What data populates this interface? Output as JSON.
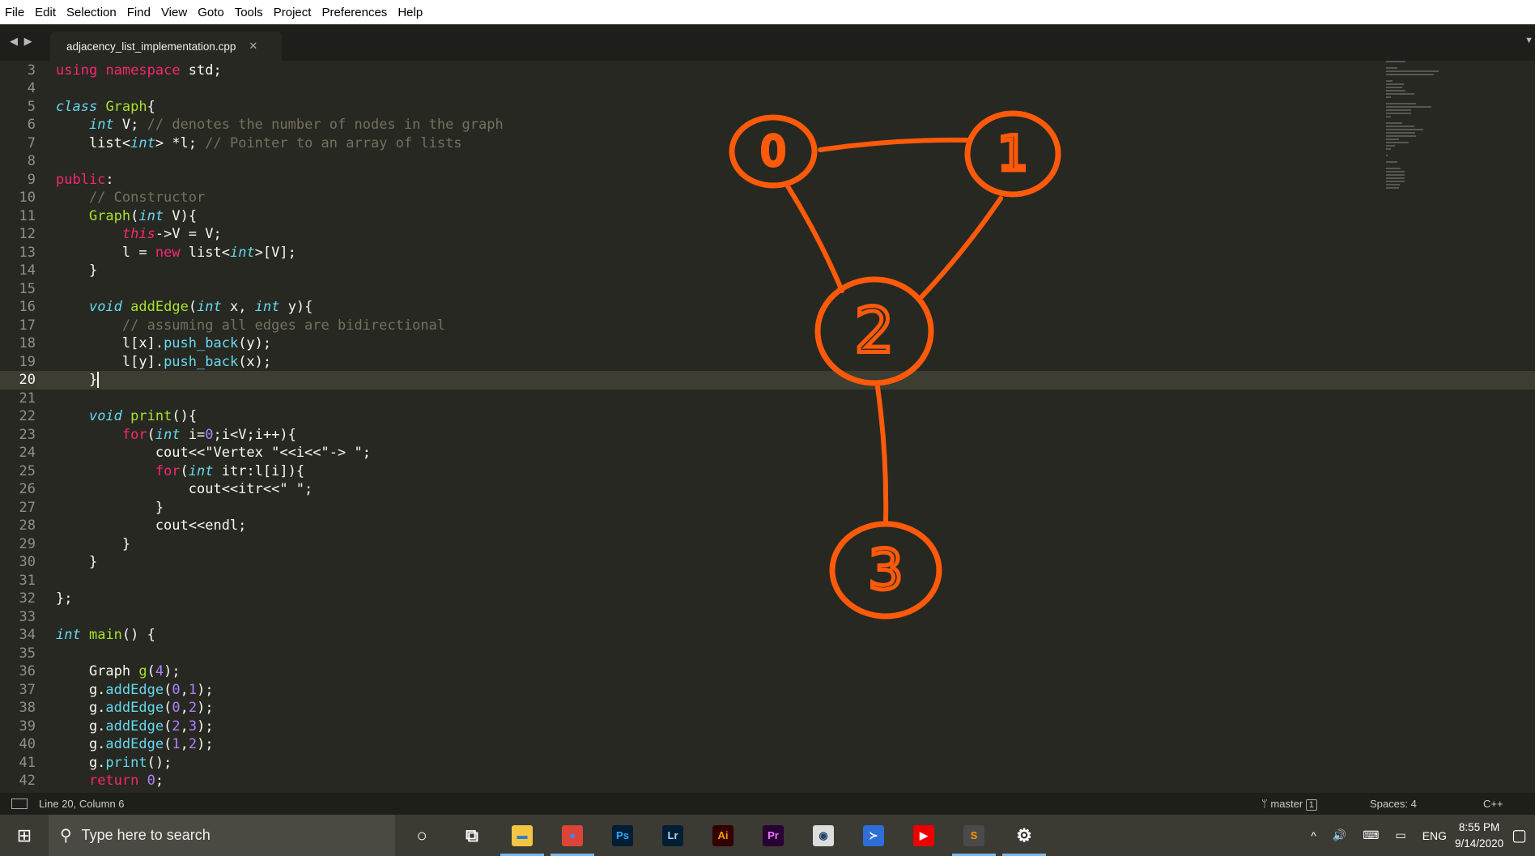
{
  "menu": [
    "File",
    "Edit",
    "Selection",
    "Find",
    "View",
    "Goto",
    "Tools",
    "Project",
    "Preferences",
    "Help"
  ],
  "tab": {
    "nav": "◀ ▶",
    "filename": "adjacency_list_implementation.cpp",
    "close": "✕"
  },
  "current_line": 20,
  "code": [
    {
      "n": "3",
      "t": [
        [
          "kw",
          "using"
        ],
        [
          "",
          " "
        ],
        [
          "kw",
          "namespace"
        ],
        [
          "",
          " std;"
        ]
      ]
    },
    {
      "n": "4",
      "t": []
    },
    {
      "n": "5",
      "t": [
        [
          "ty",
          "class"
        ],
        [
          "",
          " "
        ],
        [
          "fn",
          "Graph"
        ],
        [
          "",
          "{"
        ]
      ]
    },
    {
      "n": "6",
      "t": [
        [
          "",
          "    "
        ],
        [
          "ty",
          "int"
        ],
        [
          "",
          " V; "
        ],
        [
          "cm",
          "// denotes the number of nodes in the graph"
        ]
      ]
    },
    {
      "n": "7",
      "t": [
        [
          "",
          "    list<"
        ],
        [
          "ty",
          "int"
        ],
        [
          "",
          "> *l; "
        ],
        [
          "cm",
          "// Pointer to an array of lists"
        ]
      ]
    },
    {
      "n": "8",
      "t": []
    },
    {
      "n": "9",
      "t": [
        [
          "kw",
          "public"
        ],
        [
          "",
          ":"
        ]
      ]
    },
    {
      "n": "10",
      "t": [
        [
          "cm",
          "    // Constructor"
        ]
      ]
    },
    {
      "n": "11",
      "t": [
        [
          "",
          "    "
        ],
        [
          "fn",
          "Graph"
        ],
        [
          "",
          "("
        ],
        [
          "ty",
          "int"
        ],
        [
          "",
          " V){"
        ]
      ]
    },
    {
      "n": "12",
      "t": [
        [
          "",
          "        "
        ],
        [
          "it",
          "this"
        ],
        [
          "",
          "->V = V;"
        ]
      ]
    },
    {
      "n": "13",
      "t": [
        [
          "",
          "        l = "
        ],
        [
          "kw",
          "new"
        ],
        [
          "",
          " list<"
        ],
        [
          "ty",
          "int"
        ],
        [
          "",
          ">[V];"
        ]
      ]
    },
    {
      "n": "14",
      "t": [
        [
          "",
          "    }"
        ]
      ]
    },
    {
      "n": "15",
      "t": []
    },
    {
      "n": "16",
      "t": [
        [
          "",
          "    "
        ],
        [
          "ty",
          "void"
        ],
        [
          "",
          " "
        ],
        [
          "fn",
          "addEdge"
        ],
        [
          "",
          "("
        ],
        [
          "ty",
          "int"
        ],
        [
          "",
          " x, "
        ],
        [
          "ty",
          "int"
        ],
        [
          "",
          " y){"
        ]
      ]
    },
    {
      "n": "17",
      "t": [
        [
          "cm",
          "        // assuming all edges are bidirectional"
        ]
      ]
    },
    {
      "n": "18",
      "t": [
        [
          "",
          "        l[x]."
        ],
        [
          "ca",
          "push_back"
        ],
        [
          "",
          "(y);"
        ]
      ]
    },
    {
      "n": "19",
      "t": [
        [
          "",
          "        l[y]."
        ],
        [
          "ca",
          "push_back"
        ],
        [
          "",
          "(x);"
        ]
      ]
    },
    {
      "n": "20",
      "t": [
        [
          "",
          "    }"
        ]
      ]
    },
    {
      "n": "21",
      "t": []
    },
    {
      "n": "22",
      "t": [
        [
          "",
          "    "
        ],
        [
          "ty",
          "void"
        ],
        [
          "",
          " "
        ],
        [
          "fn",
          "print"
        ],
        [
          "",
          "(){"
        ]
      ]
    },
    {
      "n": "23",
      "t": [
        [
          "",
          "        "
        ],
        [
          "kw",
          "for"
        ],
        [
          "",
          "("
        ],
        [
          "ty",
          "int"
        ],
        [
          "",
          " i="
        ],
        [
          "nu",
          "0"
        ],
        [
          "",
          ";i<V;i++){"
        ]
      ]
    },
    {
      "n": "24",
      "t": [
        [
          "",
          "            cout<<\"Vertex \"<<i<<\"-> \";"
        ]
      ]
    },
    {
      "n": "25",
      "t": [
        [
          "",
          "            "
        ],
        [
          "kw",
          "for"
        ],
        [
          "",
          "("
        ],
        [
          "ty",
          "int"
        ],
        [
          "",
          " itr:l[i]){"
        ]
      ]
    },
    {
      "n": "26",
      "t": [
        [
          "",
          "                cout<<itr<<\" \";"
        ]
      ]
    },
    {
      "n": "27",
      "t": [
        [
          "",
          "            }"
        ]
      ]
    },
    {
      "n": "28",
      "t": [
        [
          "",
          "            cout<<endl;"
        ]
      ]
    },
    {
      "n": "29",
      "t": [
        [
          "",
          "        }"
        ]
      ]
    },
    {
      "n": "30",
      "t": [
        [
          "",
          "    }"
        ]
      ]
    },
    {
      "n": "31",
      "t": []
    },
    {
      "n": "32",
      "t": [
        [
          "",
          "};"
        ]
      ]
    },
    {
      "n": "33",
      "t": []
    },
    {
      "n": "34",
      "t": [
        [
          "ty",
          "int"
        ],
        [
          "",
          " "
        ],
        [
          "fn",
          "main"
        ],
        [
          "",
          "() {"
        ]
      ]
    },
    {
      "n": "35",
      "t": []
    },
    {
      "n": "36",
      "t": [
        [
          "",
          "    Graph "
        ],
        [
          "fn",
          "g"
        ],
        [
          "",
          "("
        ],
        [
          "nu",
          "4"
        ],
        [
          "",
          ");"
        ]
      ]
    },
    {
      "n": "37",
      "t": [
        [
          "",
          "    g."
        ],
        [
          "ca",
          "addEdge"
        ],
        [
          "",
          "("
        ],
        [
          "nu",
          "0"
        ],
        [
          "",
          ","
        ],
        [
          "nu",
          "1"
        ],
        [
          "",
          ");"
        ]
      ]
    },
    {
      "n": "38",
      "t": [
        [
          "",
          "    g."
        ],
        [
          "ca",
          "addEdge"
        ],
        [
          "",
          "("
        ],
        [
          "nu",
          "0"
        ],
        [
          "",
          ","
        ],
        [
          "nu",
          "2"
        ],
        [
          "",
          ");"
        ]
      ]
    },
    {
      "n": "39",
      "t": [
        [
          "",
          "    g."
        ],
        [
          "ca",
          "addEdge"
        ],
        [
          "",
          "("
        ],
        [
          "nu",
          "2"
        ],
        [
          "",
          ","
        ],
        [
          "nu",
          "3"
        ],
        [
          "",
          ");"
        ]
      ]
    },
    {
      "n": "40",
      "t": [
        [
          "",
          "    g."
        ],
        [
          "ca",
          "addEdge"
        ],
        [
          "",
          "("
        ],
        [
          "nu",
          "1"
        ],
        [
          "",
          ","
        ],
        [
          "nu",
          "2"
        ],
        [
          "",
          ");"
        ]
      ]
    },
    {
      "n": "41",
      "t": [
        [
          "",
          "    g."
        ],
        [
          "ca",
          "print"
        ],
        [
          "",
          "();"
        ]
      ]
    },
    {
      "n": "42",
      "t": [
        [
          "",
          "    "
        ],
        [
          "kw",
          "return"
        ],
        [
          "",
          " "
        ],
        [
          "nu",
          "0"
        ],
        [
          "",
          ";"
        ]
      ]
    }
  ],
  "drawing": {
    "color": "#ff5a0a",
    "nodes": [
      "0",
      "1",
      "2",
      "3"
    ],
    "edges": [
      [
        "0",
        "1"
      ],
      [
        "0",
        "2"
      ],
      [
        "1",
        "2"
      ],
      [
        "2",
        "3"
      ]
    ]
  },
  "status": {
    "position": "Line 20, Column 6",
    "branch": "master",
    "branch_count": "1",
    "spaces": "Spaces: 4",
    "syntax": "C++"
  },
  "taskbar": {
    "search_placeholder": "Type here to search",
    "apps": [
      {
        "name": "cortana",
        "label": "○",
        "bg": "transparent",
        "fg": "#fff"
      },
      {
        "name": "task-view",
        "label": "⧉",
        "bg": "transparent",
        "fg": "#fff"
      },
      {
        "name": "file-explorer",
        "label": "▬",
        "bg": "#f4c542",
        "fg": "#2b7cd3",
        "active": true
      },
      {
        "name": "chrome",
        "label": "●",
        "bg": "#db4437",
        "fg": "#4285f4",
        "active": true
      },
      {
        "name": "photoshop",
        "label": "Ps",
        "bg": "#001e36",
        "fg": "#31a8ff"
      },
      {
        "name": "lightroom",
        "label": "Lr",
        "bg": "#001e36",
        "fg": "#add5ec"
      },
      {
        "name": "illustrator",
        "label": "Ai",
        "bg": "#330000",
        "fg": "#ff9a00"
      },
      {
        "name": "premiere",
        "label": "Pr",
        "bg": "#2a0034",
        "fg": "#e77bff"
      },
      {
        "name": "app-globe",
        "label": "◉",
        "bg": "#ddd",
        "fg": "#246"
      },
      {
        "name": "powershell",
        "label": "≻",
        "bg": "#2d6fd6",
        "fg": "#fff"
      },
      {
        "name": "youtube-music",
        "label": "▶",
        "bg": "#e00",
        "fg": "#fff"
      },
      {
        "name": "sublime-text",
        "label": "S",
        "bg": "#4a4a4a",
        "fg": "#ff9800",
        "active": true
      },
      {
        "name": "settings",
        "label": "⚙",
        "bg": "transparent",
        "fg": "#fff",
        "active": true
      }
    ],
    "tray": {
      "chevron": "^",
      "volume": "🔊",
      "keyboard": "⌨",
      "tablet": "▭",
      "lang": "ENG",
      "time": "8:55 PM",
      "date": "9/14/2020",
      "notifications": "▢"
    }
  }
}
